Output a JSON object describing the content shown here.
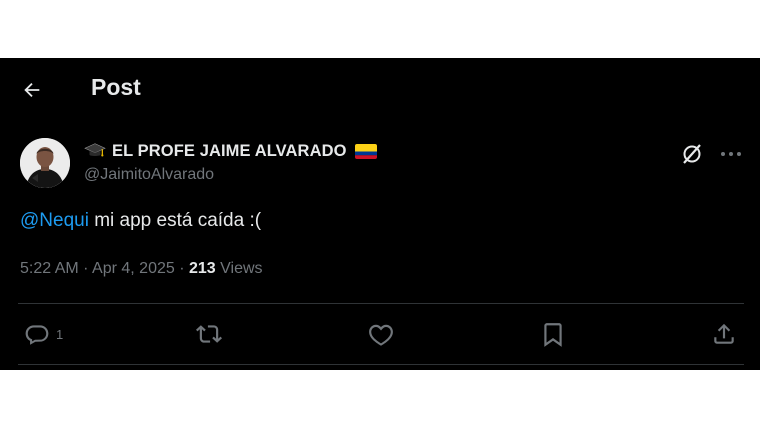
{
  "header": {
    "title": "Post"
  },
  "author": {
    "display_name": "EL PROFE JAIME ALVARADO",
    "handle": "@JaimitoAlvarado"
  },
  "post": {
    "mention": "@Nequi",
    "text": " mi app está caída :(",
    "time": "5:22 AM",
    "sep1": " · ",
    "date": "Apr 4, 2025",
    "sep2": " · ",
    "views_count": "213",
    "views_label": " Views"
  },
  "actions": {
    "reply_count": "1"
  },
  "icons": {
    "back": "arrow-left-icon",
    "grok": "grok-icon",
    "more": "more-dots-icon",
    "reply": "reply-icon",
    "repost": "repost-icon",
    "like": "heart-icon",
    "bookmark": "bookmark-icon",
    "share": "share-icon"
  },
  "colors": {
    "background": "#000000",
    "text": "#e7e9ea",
    "muted": "#71767b",
    "link": "#1d9bf0",
    "divider": "#2f3336"
  }
}
